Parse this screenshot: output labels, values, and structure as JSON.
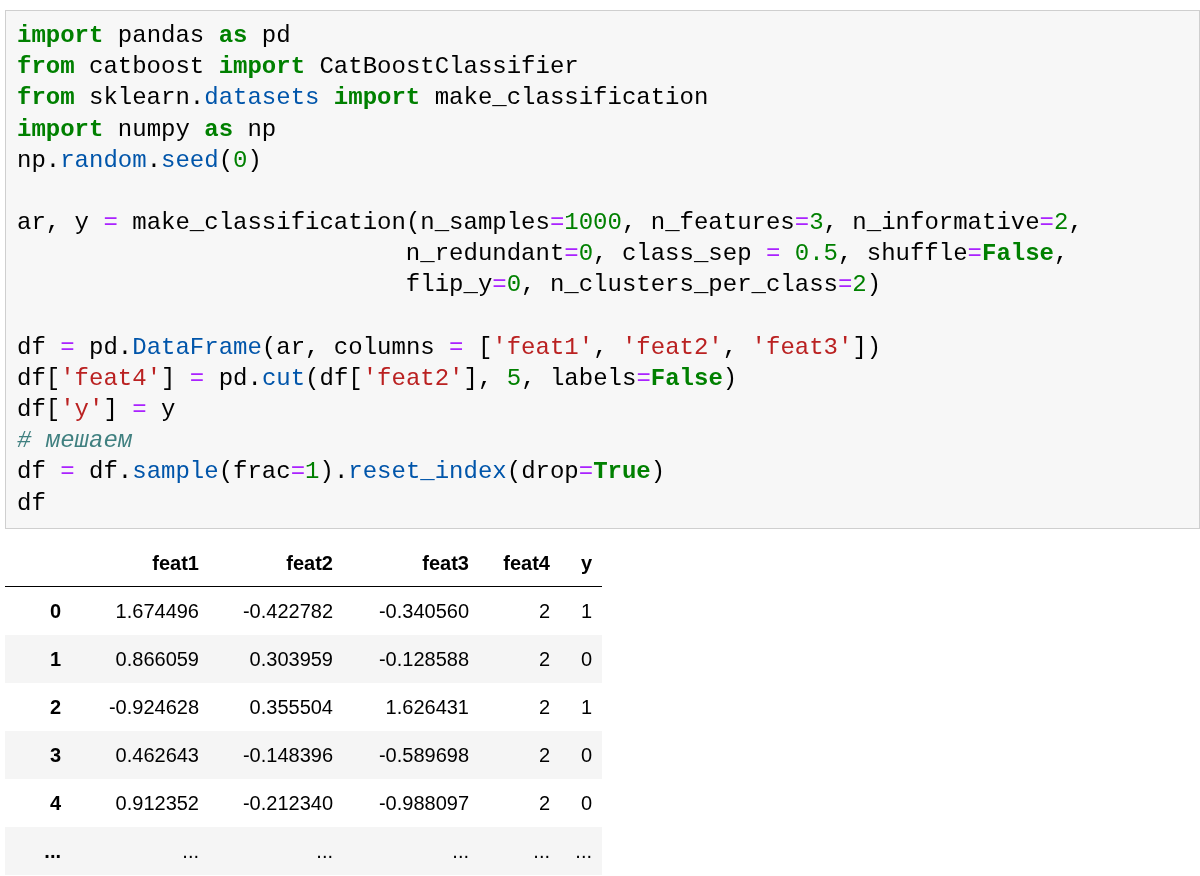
{
  "code_cell": {
    "blocks": [
      [
        [
          {
            "kind": "kw",
            "text": "import"
          },
          {
            "kind": "plain",
            "text": " pandas "
          },
          {
            "kind": "kw",
            "text": "as"
          },
          {
            "kind": "plain",
            "text": " pd"
          }
        ],
        [
          {
            "kind": "kw",
            "text": "from"
          },
          {
            "kind": "plain",
            "text": " catboost "
          },
          {
            "kind": "kw",
            "text": "import"
          },
          {
            "kind": "plain",
            "text": " CatBoostClassifier"
          }
        ],
        [
          {
            "kind": "kw",
            "text": "from"
          },
          {
            "kind": "plain",
            "text": " sklearn."
          },
          {
            "kind": "attr",
            "text": "datasets"
          },
          {
            "kind": "kw",
            "text": " import"
          },
          {
            "kind": "plain",
            "text": " make_classification"
          }
        ],
        [
          {
            "kind": "kw",
            "text": "import"
          },
          {
            "kind": "plain",
            "text": " numpy "
          },
          {
            "kind": "kw",
            "text": "as"
          },
          {
            "kind": "plain",
            "text": " np"
          }
        ],
        [
          {
            "kind": "plain",
            "text": "np."
          },
          {
            "kind": "attr",
            "text": "random"
          },
          {
            "kind": "plain",
            "text": "."
          },
          {
            "kind": "attr",
            "text": "seed"
          },
          {
            "kind": "plain",
            "text": "("
          },
          {
            "kind": "num",
            "text": "0"
          },
          {
            "kind": "plain",
            "text": ")"
          }
        ]
      ],
      [
        [
          {
            "kind": "plain",
            "text": "ar, y "
          },
          {
            "kind": "op",
            "text": "="
          },
          {
            "kind": "plain",
            "text": " make_classification(n_samples"
          },
          {
            "kind": "op",
            "text": "="
          },
          {
            "kind": "num",
            "text": "1000"
          },
          {
            "kind": "plain",
            "text": ", n_features"
          },
          {
            "kind": "op",
            "text": "="
          },
          {
            "kind": "num",
            "text": "3"
          },
          {
            "kind": "plain",
            "text": ", n_informative"
          },
          {
            "kind": "op",
            "text": "="
          },
          {
            "kind": "num",
            "text": "2"
          },
          {
            "kind": "plain",
            "text": ","
          }
        ],
        [
          {
            "kind": "plain",
            "text": "                           n_redundant"
          },
          {
            "kind": "op",
            "text": "="
          },
          {
            "kind": "num",
            "text": "0"
          },
          {
            "kind": "plain",
            "text": ", class_sep "
          },
          {
            "kind": "op",
            "text": "="
          },
          {
            "kind": "num",
            "text": " 0.5"
          },
          {
            "kind": "plain",
            "text": ", shuffle"
          },
          {
            "kind": "op",
            "text": "="
          },
          {
            "kind": "kw",
            "text": "False"
          },
          {
            "kind": "plain",
            "text": ","
          }
        ],
        [
          {
            "kind": "plain",
            "text": "                           flip_y"
          },
          {
            "kind": "op",
            "text": "="
          },
          {
            "kind": "num",
            "text": "0"
          },
          {
            "kind": "plain",
            "text": ", n_clusters_per_class"
          },
          {
            "kind": "op",
            "text": "="
          },
          {
            "kind": "num",
            "text": "2"
          },
          {
            "kind": "plain",
            "text": ")"
          }
        ]
      ],
      [
        [
          {
            "kind": "plain",
            "text": "df "
          },
          {
            "kind": "op",
            "text": "="
          },
          {
            "kind": "plain",
            "text": " pd."
          },
          {
            "kind": "attr",
            "text": "DataFrame"
          },
          {
            "kind": "plain",
            "text": "(ar, columns "
          },
          {
            "kind": "op",
            "text": "="
          },
          {
            "kind": "plain",
            "text": " ["
          },
          {
            "kind": "str",
            "text": "'feat1'"
          },
          {
            "kind": "plain",
            "text": ", "
          },
          {
            "kind": "str",
            "text": "'feat2'"
          },
          {
            "kind": "plain",
            "text": ", "
          },
          {
            "kind": "str",
            "text": "'feat3'"
          },
          {
            "kind": "plain",
            "text": "])"
          }
        ],
        [
          {
            "kind": "plain",
            "text": "df["
          },
          {
            "kind": "str",
            "text": "'feat4'"
          },
          {
            "kind": "plain",
            "text": "] "
          },
          {
            "kind": "op",
            "text": "="
          },
          {
            "kind": "plain",
            "text": " pd."
          },
          {
            "kind": "attr",
            "text": "cut"
          },
          {
            "kind": "plain",
            "text": "(df["
          },
          {
            "kind": "str",
            "text": "'feat2'"
          },
          {
            "kind": "plain",
            "text": "], "
          },
          {
            "kind": "num",
            "text": "5"
          },
          {
            "kind": "plain",
            "text": ", labels"
          },
          {
            "kind": "op",
            "text": "="
          },
          {
            "kind": "kw",
            "text": "False"
          },
          {
            "kind": "plain",
            "text": ")"
          }
        ],
        [
          {
            "kind": "plain",
            "text": "df["
          },
          {
            "kind": "str",
            "text": "'y'"
          },
          {
            "kind": "plain",
            "text": "] "
          },
          {
            "kind": "op",
            "text": "="
          },
          {
            "kind": "plain",
            "text": " y"
          }
        ],
        [
          {
            "kind": "comment",
            "text": "# мешаем"
          }
        ],
        [
          {
            "kind": "plain",
            "text": "df "
          },
          {
            "kind": "op",
            "text": "="
          },
          {
            "kind": "plain",
            "text": " df."
          },
          {
            "kind": "attr",
            "text": "sample"
          },
          {
            "kind": "plain",
            "text": "(frac"
          },
          {
            "kind": "op",
            "text": "="
          },
          {
            "kind": "num",
            "text": "1"
          },
          {
            "kind": "plain",
            "text": ")."
          },
          {
            "kind": "attr",
            "text": "reset_index"
          },
          {
            "kind": "plain",
            "text": "(drop"
          },
          {
            "kind": "op",
            "text": "="
          },
          {
            "kind": "kw",
            "text": "True"
          },
          {
            "kind": "plain",
            "text": ")"
          }
        ],
        [
          {
            "kind": "plain",
            "text": "df"
          }
        ]
      ]
    ]
  },
  "table": {
    "columns": [
      "feat1",
      "feat2",
      "feat3",
      "feat4",
      "y"
    ],
    "rows": [
      {
        "index": "0",
        "cells": [
          "1.674496",
          "-0.422782",
          "-0.340560",
          "2",
          "1"
        ]
      },
      {
        "index": "1",
        "cells": [
          "0.866059",
          "0.303959",
          "-0.128588",
          "2",
          "0"
        ]
      },
      {
        "index": "2",
        "cells": [
          "-0.924628",
          "0.355504",
          "1.626431",
          "2",
          "1"
        ]
      },
      {
        "index": "3",
        "cells": [
          "0.462643",
          "-0.148396",
          "-0.589698",
          "2",
          "0"
        ]
      },
      {
        "index": "4",
        "cells": [
          "0.912352",
          "-0.212340",
          "-0.988097",
          "2",
          "0"
        ]
      },
      {
        "index": "...",
        "cells": [
          "...",
          "...",
          "...",
          "...",
          "..."
        ]
      }
    ]
  }
}
